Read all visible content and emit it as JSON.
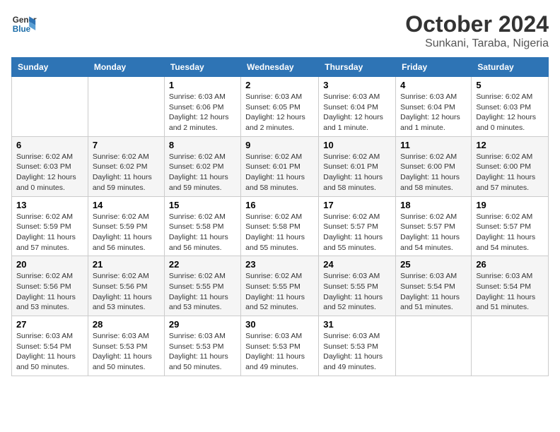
{
  "header": {
    "logo_line1": "General",
    "logo_line2": "Blue",
    "month_year": "October 2024",
    "location": "Sunkani, Taraba, Nigeria"
  },
  "weekdays": [
    "Sunday",
    "Monday",
    "Tuesday",
    "Wednesday",
    "Thursday",
    "Friday",
    "Saturday"
  ],
  "weeks": [
    [
      {
        "day": "",
        "sunrise": "",
        "sunset": "",
        "daylight": ""
      },
      {
        "day": "",
        "sunrise": "",
        "sunset": "",
        "daylight": ""
      },
      {
        "day": "1",
        "sunrise": "Sunrise: 6:03 AM",
        "sunset": "Sunset: 6:06 PM",
        "daylight": "Daylight: 12 hours and 2 minutes."
      },
      {
        "day": "2",
        "sunrise": "Sunrise: 6:03 AM",
        "sunset": "Sunset: 6:05 PM",
        "daylight": "Daylight: 12 hours and 2 minutes."
      },
      {
        "day": "3",
        "sunrise": "Sunrise: 6:03 AM",
        "sunset": "Sunset: 6:04 PM",
        "daylight": "Daylight: 12 hours and 1 minute."
      },
      {
        "day": "4",
        "sunrise": "Sunrise: 6:03 AM",
        "sunset": "Sunset: 6:04 PM",
        "daylight": "Daylight: 12 hours and 1 minute."
      },
      {
        "day": "5",
        "sunrise": "Sunrise: 6:02 AM",
        "sunset": "Sunset: 6:03 PM",
        "daylight": "Daylight: 12 hours and 0 minutes."
      }
    ],
    [
      {
        "day": "6",
        "sunrise": "Sunrise: 6:02 AM",
        "sunset": "Sunset: 6:03 PM",
        "daylight": "Daylight: 12 hours and 0 minutes."
      },
      {
        "day": "7",
        "sunrise": "Sunrise: 6:02 AM",
        "sunset": "Sunset: 6:02 PM",
        "daylight": "Daylight: 11 hours and 59 minutes."
      },
      {
        "day": "8",
        "sunrise": "Sunrise: 6:02 AM",
        "sunset": "Sunset: 6:02 PM",
        "daylight": "Daylight: 11 hours and 59 minutes."
      },
      {
        "day": "9",
        "sunrise": "Sunrise: 6:02 AM",
        "sunset": "Sunset: 6:01 PM",
        "daylight": "Daylight: 11 hours and 58 minutes."
      },
      {
        "day": "10",
        "sunrise": "Sunrise: 6:02 AM",
        "sunset": "Sunset: 6:01 PM",
        "daylight": "Daylight: 11 hours and 58 minutes."
      },
      {
        "day": "11",
        "sunrise": "Sunrise: 6:02 AM",
        "sunset": "Sunset: 6:00 PM",
        "daylight": "Daylight: 11 hours and 58 minutes."
      },
      {
        "day": "12",
        "sunrise": "Sunrise: 6:02 AM",
        "sunset": "Sunset: 6:00 PM",
        "daylight": "Daylight: 11 hours and 57 minutes."
      }
    ],
    [
      {
        "day": "13",
        "sunrise": "Sunrise: 6:02 AM",
        "sunset": "Sunset: 5:59 PM",
        "daylight": "Daylight: 11 hours and 57 minutes."
      },
      {
        "day": "14",
        "sunrise": "Sunrise: 6:02 AM",
        "sunset": "Sunset: 5:59 PM",
        "daylight": "Daylight: 11 hours and 56 minutes."
      },
      {
        "day": "15",
        "sunrise": "Sunrise: 6:02 AM",
        "sunset": "Sunset: 5:58 PM",
        "daylight": "Daylight: 11 hours and 56 minutes."
      },
      {
        "day": "16",
        "sunrise": "Sunrise: 6:02 AM",
        "sunset": "Sunset: 5:58 PM",
        "daylight": "Daylight: 11 hours and 55 minutes."
      },
      {
        "day": "17",
        "sunrise": "Sunrise: 6:02 AM",
        "sunset": "Sunset: 5:57 PM",
        "daylight": "Daylight: 11 hours and 55 minutes."
      },
      {
        "day": "18",
        "sunrise": "Sunrise: 6:02 AM",
        "sunset": "Sunset: 5:57 PM",
        "daylight": "Daylight: 11 hours and 54 minutes."
      },
      {
        "day": "19",
        "sunrise": "Sunrise: 6:02 AM",
        "sunset": "Sunset: 5:57 PM",
        "daylight": "Daylight: 11 hours and 54 minutes."
      }
    ],
    [
      {
        "day": "20",
        "sunrise": "Sunrise: 6:02 AM",
        "sunset": "Sunset: 5:56 PM",
        "daylight": "Daylight: 11 hours and 53 minutes."
      },
      {
        "day": "21",
        "sunrise": "Sunrise: 6:02 AM",
        "sunset": "Sunset: 5:56 PM",
        "daylight": "Daylight: 11 hours and 53 minutes."
      },
      {
        "day": "22",
        "sunrise": "Sunrise: 6:02 AM",
        "sunset": "Sunset: 5:55 PM",
        "daylight": "Daylight: 11 hours and 53 minutes."
      },
      {
        "day": "23",
        "sunrise": "Sunrise: 6:02 AM",
        "sunset": "Sunset: 5:55 PM",
        "daylight": "Daylight: 11 hours and 52 minutes."
      },
      {
        "day": "24",
        "sunrise": "Sunrise: 6:03 AM",
        "sunset": "Sunset: 5:55 PM",
        "daylight": "Daylight: 11 hours and 52 minutes."
      },
      {
        "day": "25",
        "sunrise": "Sunrise: 6:03 AM",
        "sunset": "Sunset: 5:54 PM",
        "daylight": "Daylight: 11 hours and 51 minutes."
      },
      {
        "day": "26",
        "sunrise": "Sunrise: 6:03 AM",
        "sunset": "Sunset: 5:54 PM",
        "daylight": "Daylight: 11 hours and 51 minutes."
      }
    ],
    [
      {
        "day": "27",
        "sunrise": "Sunrise: 6:03 AM",
        "sunset": "Sunset: 5:54 PM",
        "daylight": "Daylight: 11 hours and 50 minutes."
      },
      {
        "day": "28",
        "sunrise": "Sunrise: 6:03 AM",
        "sunset": "Sunset: 5:53 PM",
        "daylight": "Daylight: 11 hours and 50 minutes."
      },
      {
        "day": "29",
        "sunrise": "Sunrise: 6:03 AM",
        "sunset": "Sunset: 5:53 PM",
        "daylight": "Daylight: 11 hours and 50 minutes."
      },
      {
        "day": "30",
        "sunrise": "Sunrise: 6:03 AM",
        "sunset": "Sunset: 5:53 PM",
        "daylight": "Daylight: 11 hours and 49 minutes."
      },
      {
        "day": "31",
        "sunrise": "Sunrise: 6:03 AM",
        "sunset": "Sunset: 5:53 PM",
        "daylight": "Daylight: 11 hours and 49 minutes."
      },
      {
        "day": "",
        "sunrise": "",
        "sunset": "",
        "daylight": ""
      },
      {
        "day": "",
        "sunrise": "",
        "sunset": "",
        "daylight": ""
      }
    ]
  ]
}
